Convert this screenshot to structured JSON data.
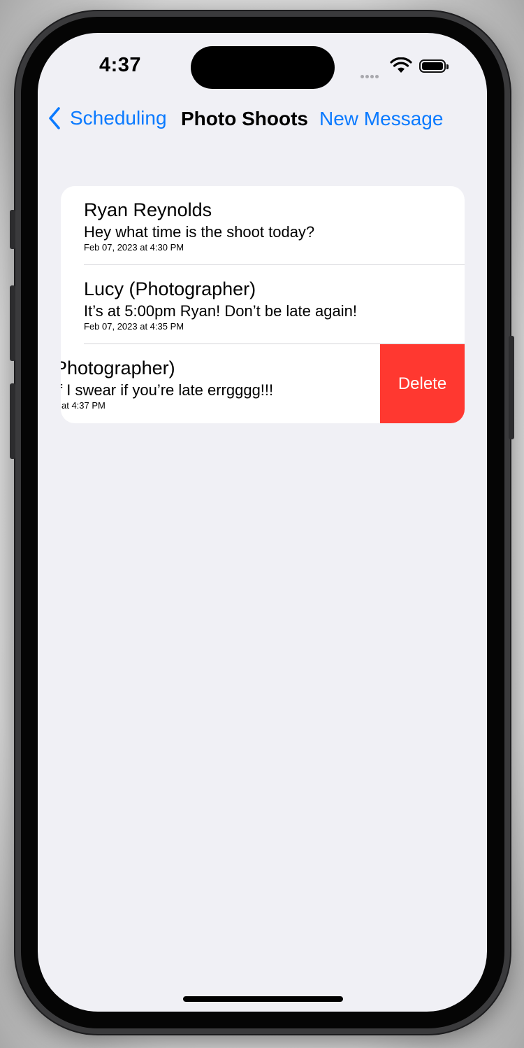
{
  "status_bar": {
    "time": "4:37"
  },
  "nav": {
    "back_label": "Scheduling",
    "title": "Photo Shoots",
    "right_label": "New Message"
  },
  "messages": [
    {
      "name": "Ryan Reynolds",
      "text": "Hey what time is the shoot today?",
      "date": "Feb 07, 2023 at 4:30 PM"
    },
    {
      "name": "Lucy (Photographer)",
      "text": "It’s at 5:00pm Ryan! Don’t be late again!",
      "date": "Feb 07, 2023 at 4:35 PM"
    },
    {
      "name": "Photographer)",
      "text": "f I swear if you’re late errgggg!!!",
      "date": "at 4:37 PM"
    }
  ],
  "swipe_action": {
    "label": "Delete",
    "color": "#ff3830"
  },
  "colors": {
    "accent": "#0a7aff",
    "background": "#f0f0f5"
  }
}
